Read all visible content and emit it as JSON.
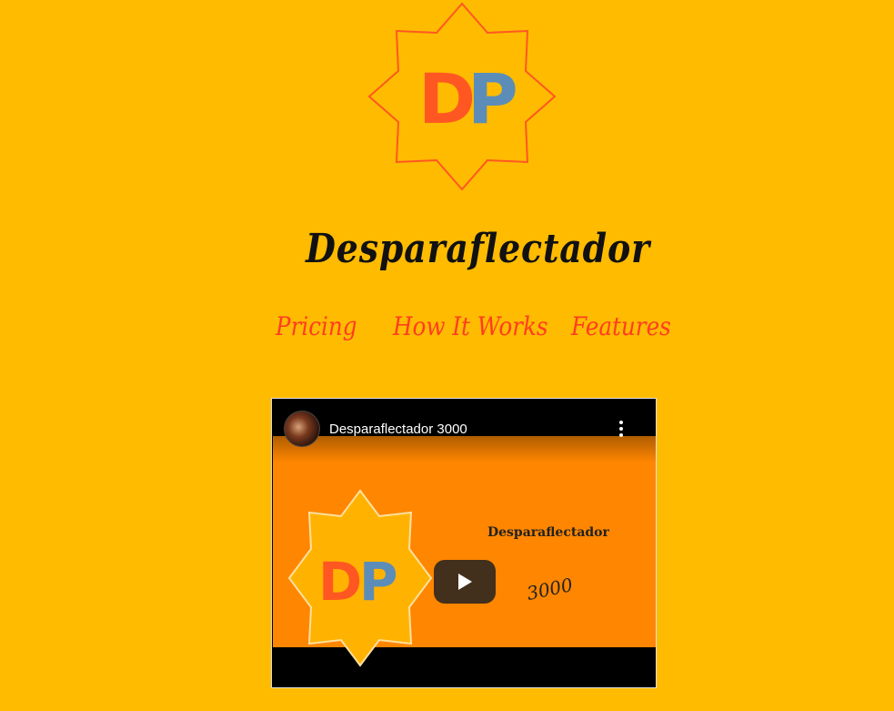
{
  "logo": {
    "letter_d": "D",
    "letter_p": "P",
    "color_d": "#FF5722",
    "color_p": "#5B8DB8",
    "outline_color": "#FF5722"
  },
  "brand": {
    "title": "Desparaflectador"
  },
  "nav": {
    "items": [
      {
        "label": "Pricing"
      },
      {
        "label": "How It Works"
      },
      {
        "label": "Features"
      }
    ],
    "color": "#FF3D21"
  },
  "video": {
    "title": "Desparaflectador 3000",
    "thumbnail": {
      "letter_d": "D",
      "letter_p": "P",
      "title": "Desparaflectador",
      "number": "3000"
    },
    "icons": {
      "play": "play-icon",
      "more": "more-vertical-icon"
    }
  },
  "colors": {
    "background": "#FFBB00",
    "video_bg": "#FF8600"
  }
}
